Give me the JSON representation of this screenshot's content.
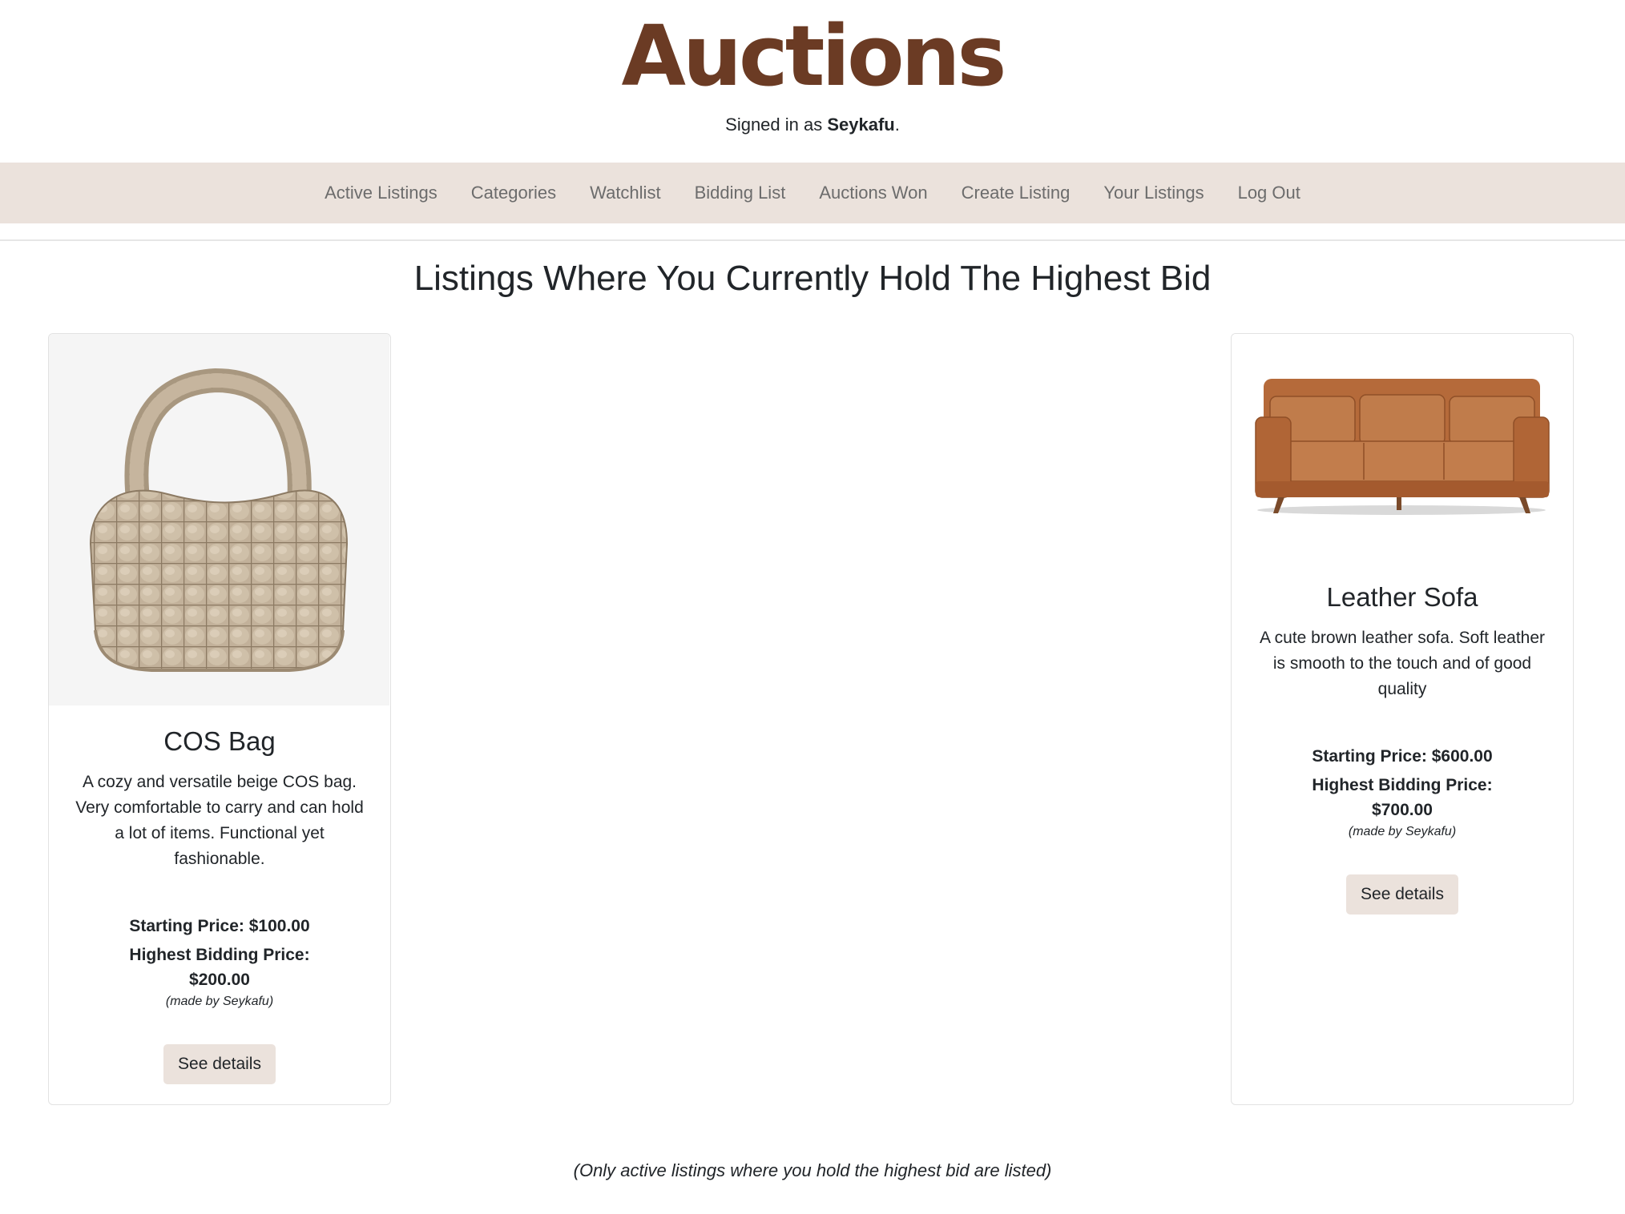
{
  "header": {
    "title": "Auctions",
    "signed_in_prefix": "Signed in as ",
    "username": "Seykafu",
    "signed_in_suffix": "."
  },
  "nav": {
    "items": [
      {
        "label": "Active Listings"
      },
      {
        "label": "Categories"
      },
      {
        "label": "Watchlist"
      },
      {
        "label": "Bidding List"
      },
      {
        "label": "Auctions Won"
      },
      {
        "label": "Create Listing"
      },
      {
        "label": "Your Listings"
      },
      {
        "label": "Log Out"
      }
    ]
  },
  "page": {
    "heading": "Listings Where You Currently Hold The Highest Bid",
    "footer_note": "(Only active listings where you hold the highest bid are listed)"
  },
  "listings": [
    {
      "title": "COS Bag",
      "description": "A cozy and versatile beige COS bag. Very comfortable to carry and can hold a lot of items. Functional yet fashionable.",
      "starting_price": "Starting Price: $100.00",
      "highest_bid_label": "Highest Bidding Price:",
      "highest_bid_value": "$200.00",
      "made_by": "(made by Seykafu)",
      "button_label": "See details"
    },
    {
      "title": "Leather Sofa",
      "description": "A cute brown leather sofa. Soft leather is smooth to the touch and of good quality",
      "starting_price": "Starting Price: $600.00",
      "highest_bid_label": "Highest Bidding Price:",
      "highest_bid_value": "$700.00",
      "made_by": "(made by Seykafu)",
      "button_label": "See details"
    }
  ],
  "colors": {
    "brand": "#6b3b24",
    "nav_bg": "#ebe2dc",
    "nav_text": "#6c6c6c",
    "button_bg": "#ebe2dc"
  }
}
